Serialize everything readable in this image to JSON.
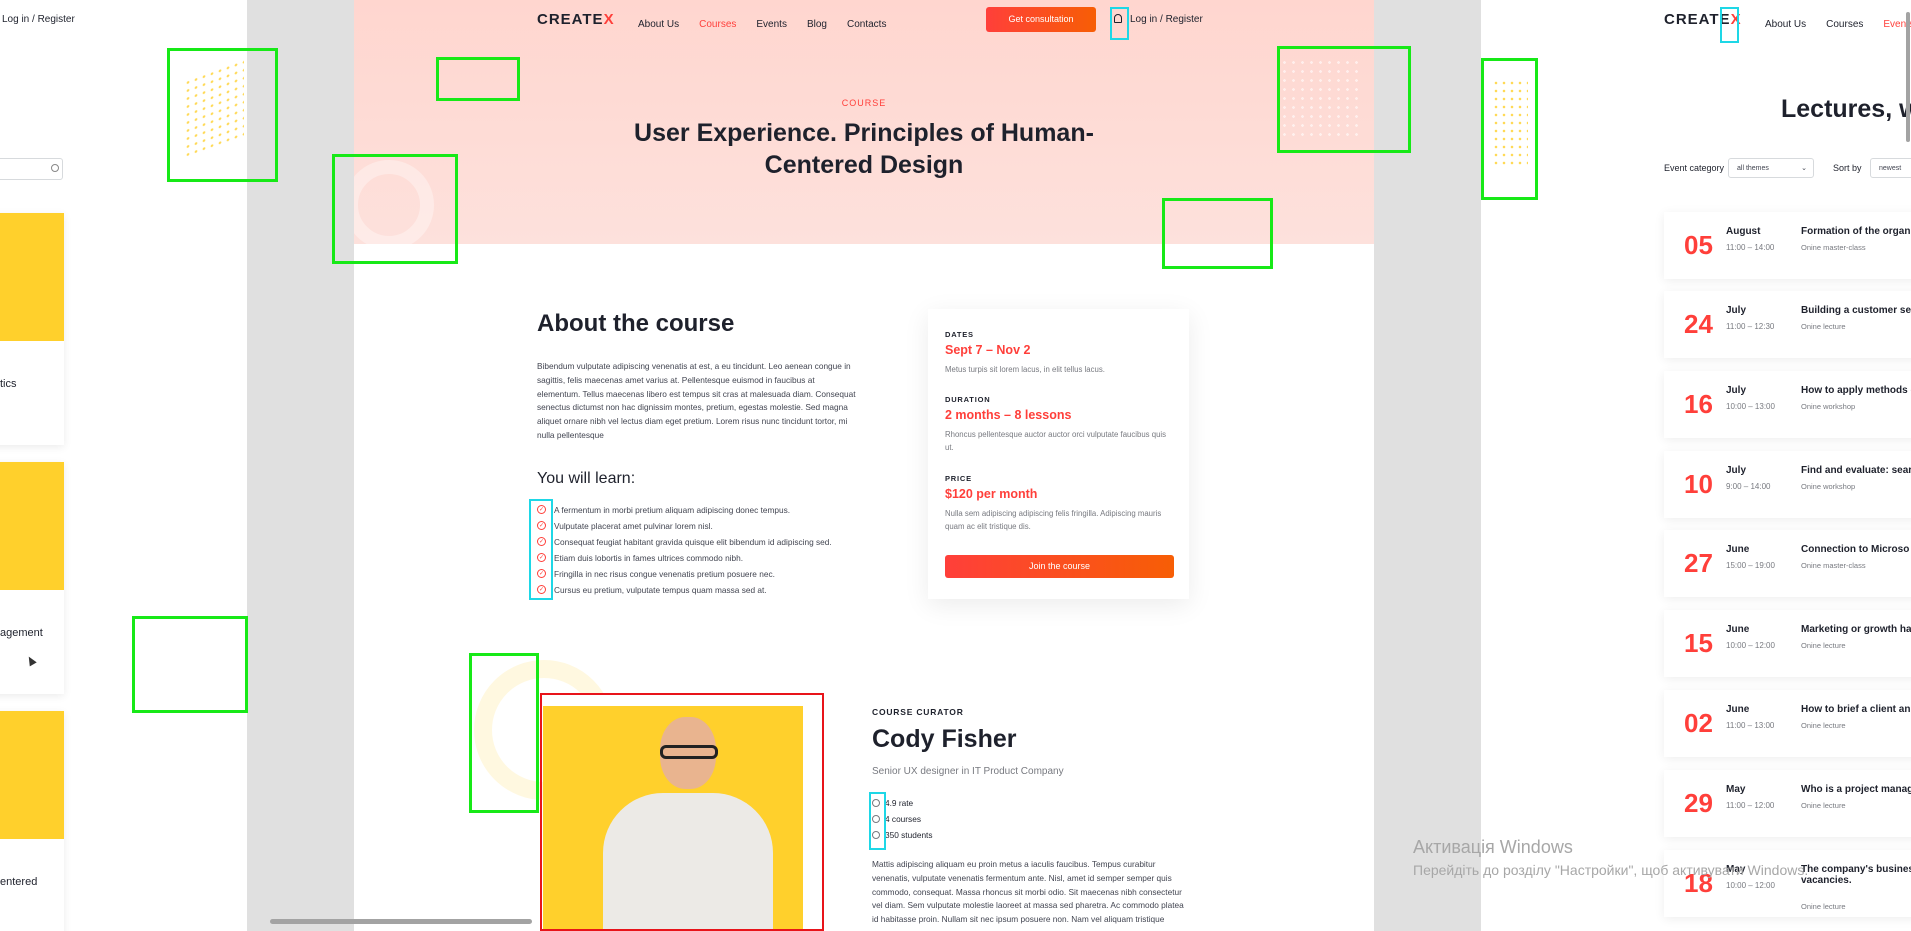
{
  "left": {
    "login": "Log in / Register",
    "titles": [
      "tics",
      "agement",
      "entered"
    ]
  },
  "center": {
    "logo": "CREATE",
    "logo_x": "X",
    "nav": [
      "About Us",
      "Courses",
      "Events",
      "Blog",
      "Contacts"
    ],
    "nav_active": "Courses",
    "cta": "Get consultation",
    "login": "Log in / Register",
    "eyebrow": "COURSE",
    "title": "User Experience. Principles of Human-Centered Design",
    "about_title": "About the course",
    "about_text": "Bibendum vulputate adipiscing venenatis at est, a eu tincidunt. Leo aenean congue in sagittis, felis maecenas amet varius at. Pellentesque euismod in faucibus at elementum. Tellus maecenas libero est tempus sit cras at malesuada diam. Consequat senectus dictumst non hac dignissim montes, pretium, egestas molestie. Sed magna aliquet ornare nibh vel lectus diam eget pretium. Lorem risus nunc tincidunt tortor, mi nulla pellentesque",
    "learn_title": "You will learn:",
    "learn": [
      "A fermentum in morbi pretium aliquam adipiscing donec tempus.",
      "Vulputate placerat amet pulvinar lorem nisl.",
      "Consequat feugiat habitant gravida quisque elit bibendum id adipiscing sed.",
      "Etiam duis lobortis in fames ultrices commodo nibh.",
      "Fringilla in nec risus congue venenatis pretium posuere nec.",
      "Cursus eu pretium, vulputate tempus quam massa sed at."
    ],
    "info": {
      "dates_label": "DATES",
      "dates_value": "Sept 7 – Nov 2",
      "dates_desc": "Metus turpis sit lorem lacus, in elit tellus lacus.",
      "duration_label": "DURATION",
      "duration_value": "2 months – 8 lessons",
      "duration_desc": "Rhoncus pellentesque auctor auctor orci vulputate faucibus quis ut.",
      "price_label": "PRICE",
      "price_value": "$120 per month",
      "price_desc": "Nulla sem adipiscing adipiscing felis fringilla. Adipiscing mauris quam ac elit tristique dis.",
      "join": "Join the course"
    },
    "curator": {
      "label": "COURSE CURATOR",
      "name": "Cody Fisher",
      "role": "Senior UX designer in IT Product Company",
      "rate": "4.9 rate",
      "courses": "4 courses",
      "students": "350 students",
      "bio": "Mattis adipiscing aliquam eu proin metus a iaculis faucibus. Tempus curabitur venenatis, vulputate venenatis fermentum ante. Nisl, amet id semper semper quis commodo, consequat. Massa rhoncus sit morbi odio. Sit maecenas nibh consectetur vel diam. Sem vulputate molestie laoreet at massa sed pharetra. Ac commodo platea id habitasse proin. Nullam sit nec ipsum posuere non. Nam vel aliquam tristique"
    }
  },
  "right": {
    "logo": "CREATE",
    "logo_x": "X",
    "nav": [
      "About Us",
      "Courses",
      "Events"
    ],
    "nav_active": "Events",
    "heading": "Lectures, w",
    "category_label": "Event category",
    "category_value": "all themes",
    "sort_label": "Sort by",
    "sort_value": "newest",
    "events": [
      {
        "day": "05",
        "month": "August",
        "time": "11:00 – 14:00",
        "title": "Formation of the organ",
        "type": "Onine master-class"
      },
      {
        "day": "24",
        "month": "July",
        "time": "11:00 – 12:30",
        "title": "Building a customer ser",
        "type": "Onine lecture"
      },
      {
        "day": "16",
        "month": "July",
        "time": "10:00 – 13:00",
        "title": "How to apply methods o",
        "type": "Onine workshop"
      },
      {
        "day": "10",
        "month": "July",
        "time": "9:00 – 14:00",
        "title": "Find and evaluate: sear",
        "type": "Onine workshop"
      },
      {
        "day": "27",
        "month": "June",
        "time": "15:00 – 19:00",
        "title": "Connection to Microso",
        "type": "Onine master-class"
      },
      {
        "day": "15",
        "month": "June",
        "time": "10:00 – 12:00",
        "title": "Marketing or growth ha",
        "type": "Onine lecture"
      },
      {
        "day": "02",
        "month": "June",
        "time": "11:00 – 13:00",
        "title": "How to brief a client an",
        "type": "Onine lecture"
      },
      {
        "day": "29",
        "month": "May",
        "time": "11:00 – 12:00",
        "title": "Who is a project manag",
        "type": "Onine lecture"
      },
      {
        "day": "18",
        "month": "May",
        "time": "10:00 – 12:00",
        "title": "The company's busines vacancies.",
        "type": "Onine lecture"
      }
    ]
  },
  "windows": {
    "line1": "Активація Windows",
    "line2": "Перейдіть до розділу \"Настройки\", щоб активувати Windows."
  },
  "colors": {
    "accent": "#ff3f3a",
    "yellow": "#ffd02c",
    "hero": "#ffd6cf",
    "overlay_green": "#17e917",
    "overlay_cyan": "#1ed7e6",
    "overlay_red": "#e8141a"
  }
}
